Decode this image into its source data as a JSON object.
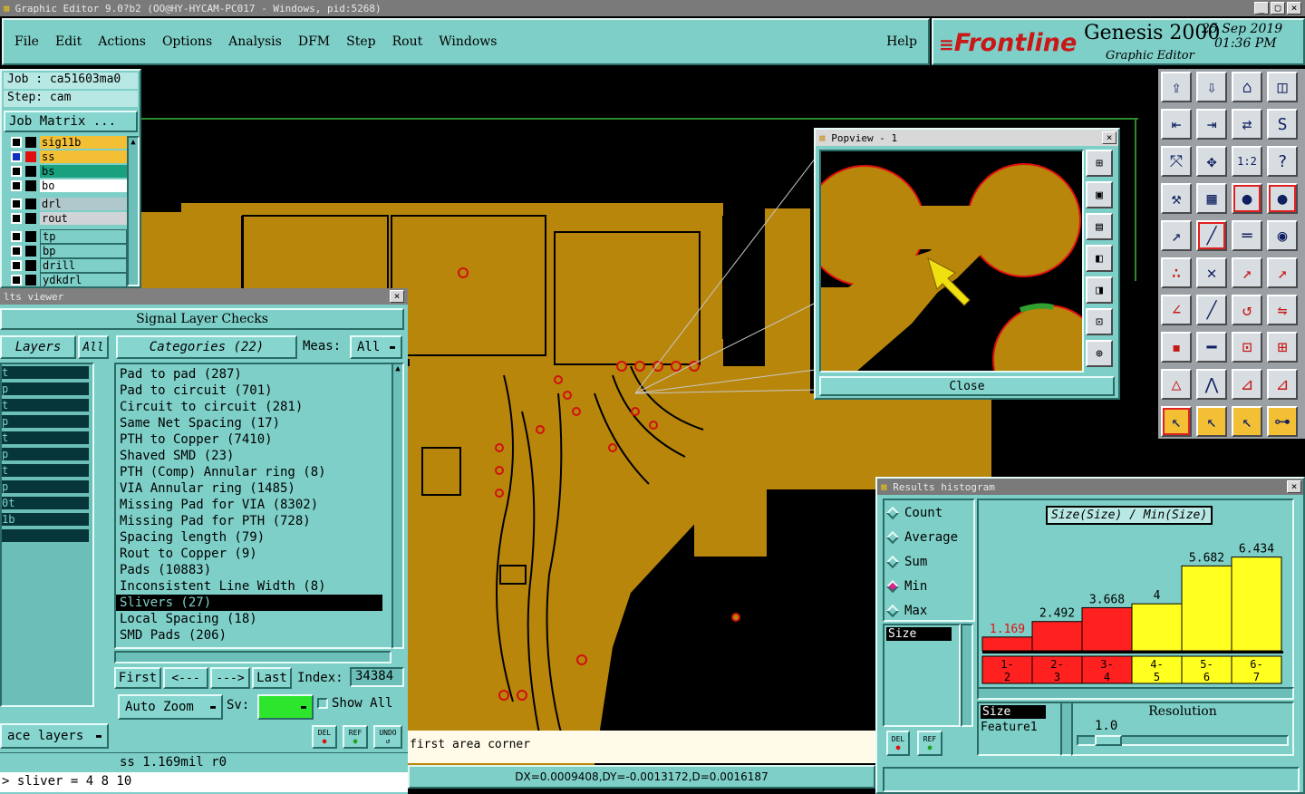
{
  "window_title": "Graphic Editor 9.0?b2 (OO@HY-HYCAM-PC017 - Windows, pid:5268)",
  "menu": [
    "File",
    "Edit",
    "Actions",
    "Options",
    "Analysis",
    "DFM",
    "Step",
    "Rout",
    "Windows"
  ],
  "help": "Help",
  "brand": {
    "logo": "Frontline",
    "product": "Genesis 2000",
    "subtitle": "Graphic Editor",
    "date": "25 Sep 2019",
    "time": "01:36 PM"
  },
  "job": {
    "job": "Job : ca51603ma0",
    "step": "Step: cam",
    "matrix_btn": "Job Matrix ..."
  },
  "layers": [
    {
      "name": "sig11b",
      "color": "#f3bf35"
    },
    {
      "name": "ss",
      "color": "#f3bf35"
    },
    {
      "name": "bs",
      "color": "#19a07f"
    },
    {
      "name": "bo",
      "color": "#ffffff"
    },
    {
      "name": "drl",
      "color": "#b0c8cc"
    },
    {
      "name": "rout",
      "color": "#d0d4d6"
    },
    {
      "name": "tp",
      "color": "#7ecfc8"
    },
    {
      "name": "bp",
      "color": "#7ecfc8"
    },
    {
      "name": "drill",
      "color": "#7ecfc8"
    },
    {
      "name": "ydkdrl",
      "color": "#7ecfc8"
    }
  ],
  "results_viewer": {
    "title": "lts viewer",
    "heading": "Signal Layer Checks",
    "layers_btn": "Layers",
    "all_btn": "All",
    "categories_btn": "Categories (22)",
    "meas_label": "Meas:",
    "meas_value": "All",
    "left_items": [
      "t",
      "p",
      "t",
      "p",
      "t",
      "p",
      "t",
      "p",
      "0t",
      "1b",
      ""
    ],
    "categories": [
      "Pad to pad (287)",
      "Pad to circuit (701)",
      "Circuit to circuit (281)",
      "Same Net Spacing (17)",
      "PTH to Copper (7410)",
      "Shaved SMD (23)",
      "PTH (Comp) Annular ring (8)",
      "VIA Annular ring (1485)",
      "Missing Pad for VIA (8302)",
      "Missing Pad for PTH (728)",
      "Spacing length (79)",
      "Rout to Copper (9)",
      "Pads (10883)",
      "Inconsistent Line Width (8)",
      "Slivers (27)",
      "Local Spacing (18)",
      "SMD Pads (206)"
    ],
    "selected_index": 14,
    "nav": {
      "first": "First",
      "prev": "<---",
      "next": "--->",
      "last": "Last",
      "index_label": "Index:",
      "index_value": "34384"
    },
    "zoom": "Auto Zoom",
    "sv_label": "Sv:",
    "show_all": "Show All",
    "replace_layers": "ace layers",
    "icons": [
      "DEL",
      "REF",
      "UNDO"
    ]
  },
  "status": {
    "info": "ss  1.169mil  r0",
    "command": "> sliver = 4 8 10",
    "prompt": "first area corner",
    "coords": "DX=0.0009408,DY=-0.0013172,D=0.0016187"
  },
  "popview": {
    "title": "Popview - 1",
    "close": "Close"
  },
  "histogram": {
    "title": "Results histogram",
    "modes": [
      "Count",
      "Average",
      "Sum",
      "Min",
      "Max"
    ],
    "selected_mode": "Min",
    "list_label": "Size",
    "chart_title": "Size(Size) / Min(Size)",
    "bottom_list": [
      "Size",
      "Feature1"
    ],
    "resolution_label": "Resolution",
    "resolution_value": "1.0",
    "icons": [
      "DEL",
      "REF"
    ]
  },
  "chart_data": {
    "type": "bar",
    "title": "Size(Size) / Min(Size)",
    "categories": [
      "1-2",
      "2-3",
      "3-4",
      "4-5",
      "5-6",
      "6-7"
    ],
    "values": [
      1.169,
      2.492,
      3.668,
      4,
      5.682,
      6.434
    ],
    "labels": [
      "1.169",
      "2.492",
      "3.668",
      "4",
      "5.682",
      "6.434"
    ],
    "colors": [
      "#ff2020",
      "#ff2020",
      "#ff2020",
      "#ffff20",
      "#ffff20",
      "#ffff20"
    ],
    "ylim": [
      0,
      7
    ]
  }
}
